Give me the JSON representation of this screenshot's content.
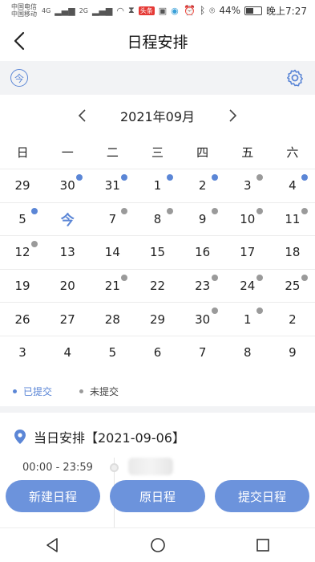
{
  "status": {
    "carrier1": "中国电信",
    "carrier2": "中国移动",
    "net1": "4G",
    "net2": "2G",
    "app_badge": "头条",
    "battery": "44%",
    "battery_level": 0.44,
    "time": "晚上7:27"
  },
  "header": {
    "title": "日程安排"
  },
  "toolbar": {
    "today_label": "今"
  },
  "calendar": {
    "month": "2021年09月",
    "weekdays": [
      "日",
      "一",
      "二",
      "三",
      "四",
      "五",
      "六"
    ],
    "rows": [
      [
        {
          "d": "29",
          "dot": ""
        },
        {
          "d": "30",
          "dot": "blue"
        },
        {
          "d": "31",
          "dot": "blue"
        },
        {
          "d": "1",
          "dot": "blue"
        },
        {
          "d": "2",
          "dot": "blue"
        },
        {
          "d": "3",
          "dot": "gray"
        },
        {
          "d": "4",
          "dot": "blue"
        }
      ],
      [
        {
          "d": "5",
          "dot": "blue"
        },
        {
          "d": "今",
          "dot": "",
          "today": true
        },
        {
          "d": "7",
          "dot": "gray"
        },
        {
          "d": "8",
          "dot": "gray"
        },
        {
          "d": "9",
          "dot": "gray"
        },
        {
          "d": "10",
          "dot": "gray"
        },
        {
          "d": "11",
          "dot": "gray"
        }
      ],
      [
        {
          "d": "12",
          "dot": "gray"
        },
        {
          "d": "13",
          "dot": ""
        },
        {
          "d": "14",
          "dot": ""
        },
        {
          "d": "15",
          "dot": ""
        },
        {
          "d": "16",
          "dot": ""
        },
        {
          "d": "17",
          "dot": ""
        },
        {
          "d": "18",
          "dot": ""
        }
      ],
      [
        {
          "d": "19",
          "dot": ""
        },
        {
          "d": "20",
          "dot": ""
        },
        {
          "d": "21",
          "dot": "gray"
        },
        {
          "d": "22",
          "dot": ""
        },
        {
          "d": "23",
          "dot": "gray"
        },
        {
          "d": "24",
          "dot": "gray"
        },
        {
          "d": "25",
          "dot": "gray"
        }
      ],
      [
        {
          "d": "26",
          "dot": ""
        },
        {
          "d": "27",
          "dot": ""
        },
        {
          "d": "28",
          "dot": ""
        },
        {
          "d": "29",
          "dot": ""
        },
        {
          "d": "30",
          "dot": "gray"
        },
        {
          "d": "1",
          "dot": "gray"
        },
        {
          "d": "2",
          "dot": ""
        }
      ],
      [
        {
          "d": "3",
          "dot": ""
        },
        {
          "d": "4",
          "dot": ""
        },
        {
          "d": "5",
          "dot": ""
        },
        {
          "d": "6",
          "dot": ""
        },
        {
          "d": "7",
          "dot": ""
        },
        {
          "d": "8",
          "dot": ""
        },
        {
          "d": "9",
          "dot": ""
        }
      ]
    ]
  },
  "legend": {
    "submitted": "已提交",
    "unsubmitted": "未提交"
  },
  "schedule": {
    "title": "当日安排【2021-09-06】",
    "entry_time": "00:00 - 23:59"
  },
  "actions": {
    "new": "新建日程",
    "original": "原日程",
    "submit": "提交日程"
  },
  "colors": {
    "accent": "#5b86d6",
    "button": "#6c93dc",
    "submitted": "#5b86d6",
    "unsubmitted": "#9a9a9a"
  }
}
